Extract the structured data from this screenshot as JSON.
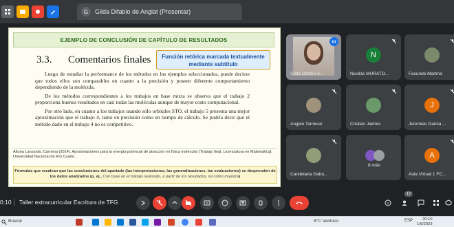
{
  "window": {
    "tab_title": "Gilda Difabio de Anglat (Presentar)",
    "tab_icon": "G"
  },
  "slide": {
    "header": "EJEMPLO DE CONCLUSIÓN DE CAPÍTULO DE RESULTADOS",
    "section_number": "3.3.",
    "section_title": "Comentarios finales",
    "callout": "Función retórica marcada textualmente mediante subtítulo",
    "paragraphs": [
      "Luego de estudiar la performance de los métodos en los ejemplos seleccionados, puede decirse que todos ellos son comparables en cuanto a la precisión y poseen diferente comportamiento dependiendo de la molécula.",
      "De los métodos correspondientes a los trabajos en base mixta se observa que el trabajo 2 proporciona buenos resultados en casi todas las moléculas aunque de mayor costo computacional.",
      "Por otro lado, en cuanto a los trabajos usando sólo orbitales STO, el trabajo 5 presenta una mejor aproximación que el trabajo 4, tanto en precisión como en tiempo de cálculo. Se podría decir que el método dado en el trabajo 4 no es competitivo."
    ],
    "reference": "Altuna Lanzardo, Carmina (2014). Aproximaciones para la energía potencial de atracción en física molecular [Trabajo final, Licenciatura en Matemática]. Universidad Nacional de Río Cuarto.",
    "note_main": "Fórmulas que recalcan que las conclusiones del apartado (las interpretaciones, las generalizaciones, las evaluaciones) se desprenden de los datos analizados (p. ej.,",
    "note_italic": "Con base en el trabajo realizado, a partir de los resultados, tal como muestra",
    "note_end": ")"
  },
  "participants": [
    {
      "name": "Gilda Difabio d...",
      "avatar": "",
      "color": "#8b8d92"
    },
    {
      "name": "Nicolás MURATO...",
      "avatar": "N",
      "color": "#188038"
    },
    {
      "name": "Facundo Martina",
      "avatar": "",
      "color": "#7a8a6a"
    },
    {
      "name": "Angelo Tarnioso",
      "avatar": "",
      "color": "#a1927c"
    },
    {
      "name": "Cristian Jaimes",
      "avatar": "",
      "color": "#6b9a6a"
    },
    {
      "name": "Jeremias Garcia ...",
      "avatar": "J",
      "color": "#e8710a"
    },
    {
      "name": "Candelaria Gabu...",
      "avatar": "",
      "color": "#8f9e76"
    },
    {
      "name": "8 más",
      "avatar": "",
      "color": "#5f6368"
    },
    {
      "name": "Aula Virtual 1 FC...",
      "avatar": "A",
      "color": "#e8710a"
    }
  ],
  "meeting": {
    "time": "0:10",
    "title": "Taller extracurricular Escritura de TFG",
    "participants_count": "17"
  },
  "taskbar": {
    "search": "Buscar",
    "weather": "8°C Ventoso",
    "lang": "ESP",
    "clock_time": "20:10",
    "clock_date": "1/6/2023"
  },
  "colors": {
    "slide_header_green": "#2e6b1e",
    "callout_blue": "#1a4f9c",
    "callout_border": "#d59a1d",
    "end_call_red": "#ea4335"
  }
}
